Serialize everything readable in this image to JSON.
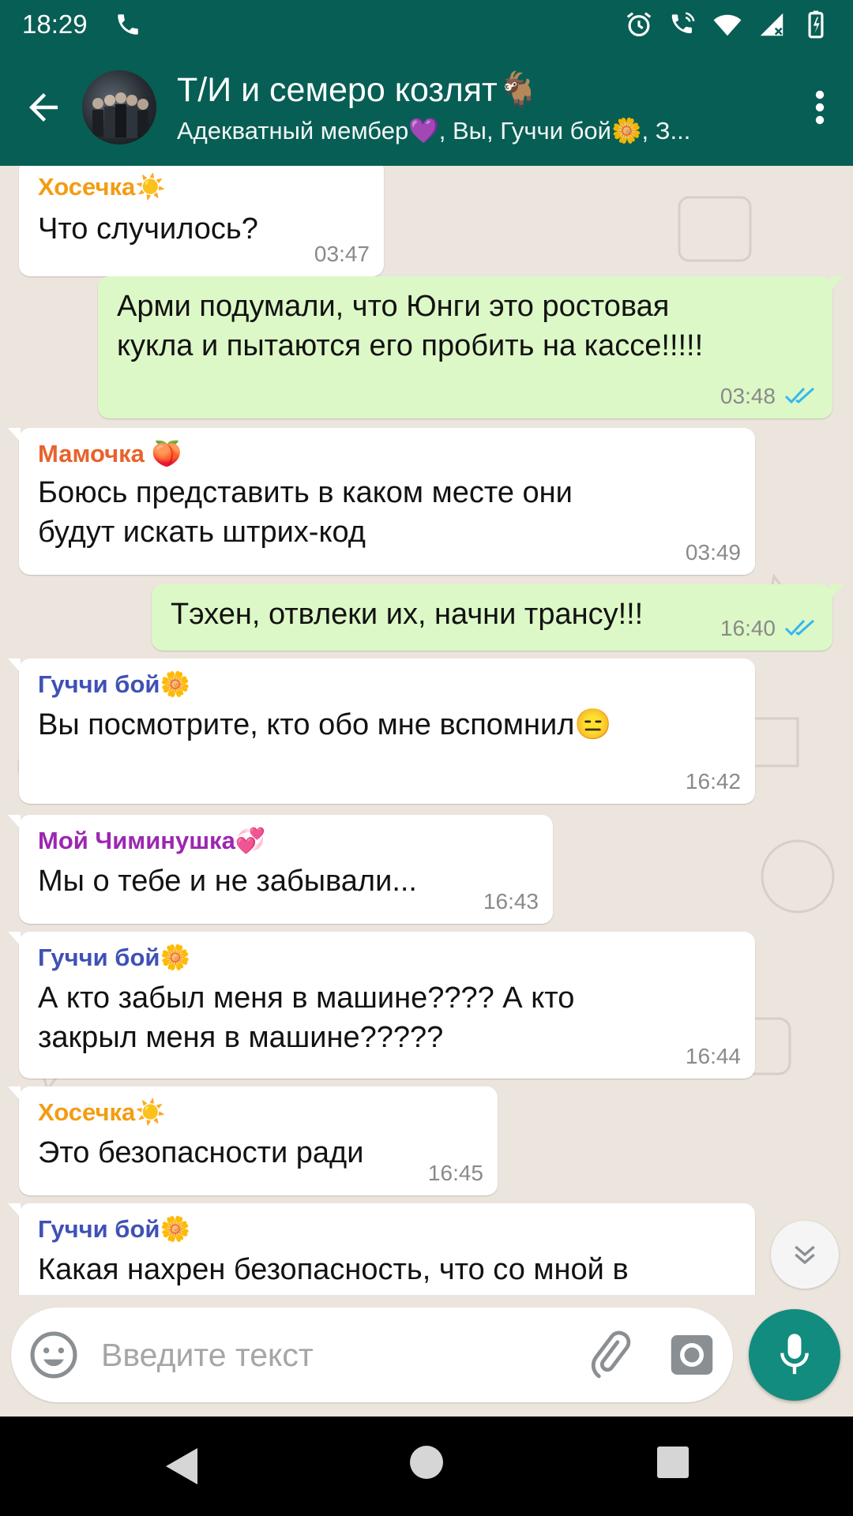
{
  "status_bar": {
    "time": "18:29",
    "icons": [
      "phone-icon",
      "alarm-icon",
      "wifi-calling-icon",
      "wifi-icon",
      "signal-icon",
      "battery-icon"
    ]
  },
  "header": {
    "title": "Т/И и семеро козлят🐐",
    "subtitle": "Адекватный мембер💜, Вы, Гуччи бой🌼, З...",
    "icons": [
      "back-arrow-icon",
      "group-avatar",
      "more-vert-icon"
    ]
  },
  "messages": [
    {
      "direction": "in",
      "sender": "Хосечка☀️",
      "sender_color": "#f39c12",
      "lines": [
        "Что случилось?"
      ],
      "time": "03:47"
    },
    {
      "direction": "out",
      "sender": "",
      "lines": [
        "Арми подумали, что Юнги это ростовая",
        "кукла и пытаются его пробить на кассе!!!!!"
      ],
      "time": "03:48",
      "status": "read"
    },
    {
      "direction": "in",
      "sender": "Мамочка 🍑",
      "sender_color": "#e8622c",
      "lines": [
        "Боюсь представить в каком месте они",
        "будут искать штрих-код"
      ],
      "time": "03:49"
    },
    {
      "direction": "out",
      "sender": "",
      "lines": [
        "Тэхен, отвлеки их, начни трансу!!!"
      ],
      "time": "16:40",
      "status": "read"
    },
    {
      "direction": "in",
      "sender": "Гуччи бой🌼",
      "sender_color": "#3f51b5",
      "lines": [
        "Вы посмотрите, кто обо мне вспомнил😑"
      ],
      "time": "16:42"
    },
    {
      "direction": "in",
      "sender": "Мой Чиминушка💞",
      "sender_color": "#9c27b0",
      "lines": [
        "Мы о тебе и не забывали..."
      ],
      "time": "16:43"
    },
    {
      "direction": "in",
      "sender": "Гуччи бой🌼",
      "sender_color": "#3f51b5",
      "lines": [
        "А кто забыл меня в машине???? А кто",
        "закрыл меня в машине?????"
      ],
      "time": "16:44"
    },
    {
      "direction": "in",
      "sender": "Хосечка☀️",
      "sender_color": "#f39c12",
      "lines": [
        "Это безопасности ради"
      ],
      "time": "16:45"
    },
    {
      "direction": "in",
      "sender": "Гуччи бой🌼",
      "sender_color": "#3f51b5",
      "lines": [
        "Какая нахрен безопасность, что со мной в"
      ],
      "time": ""
    }
  ],
  "composer": {
    "placeholder": "Введите текст",
    "value": "",
    "icons": [
      "emoji-icon",
      "paperclip-icon",
      "camera-icon",
      "mic-icon"
    ]
  },
  "scroll_button": {
    "icon": "double-chevron-down-icon"
  },
  "colors": {
    "primary": "#075e54",
    "accent": "#128c7e",
    "chat_background": "#ece5dd",
    "incoming_bubble": "#ffffff",
    "outgoing_bubble": "#dcf8c6",
    "read_ticks": "#34b7f1"
  }
}
